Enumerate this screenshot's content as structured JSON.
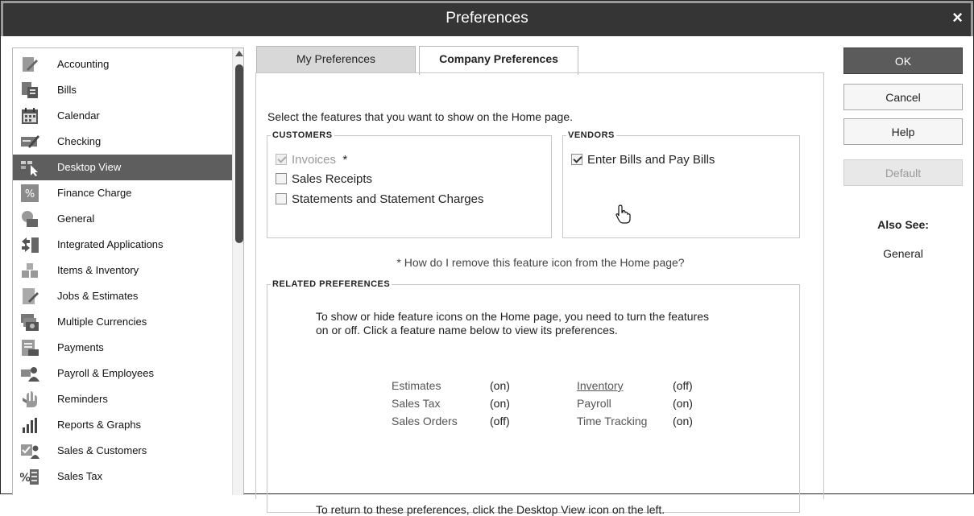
{
  "window": {
    "title": "Preferences",
    "close_glyph": "×"
  },
  "sidebar": {
    "items": [
      {
        "label": "Accounting",
        "icon": "accounting-icon"
      },
      {
        "label": "Bills",
        "icon": "bills-icon"
      },
      {
        "label": "Calendar",
        "icon": "calendar-icon"
      },
      {
        "label": "Checking",
        "icon": "checking-icon"
      },
      {
        "label": "Desktop View",
        "icon": "desktop-view-icon"
      },
      {
        "label": "Finance Charge",
        "icon": "finance-charge-icon"
      },
      {
        "label": "General",
        "icon": "general-icon"
      },
      {
        "label": "Integrated Applications",
        "icon": "integrated-applications-icon"
      },
      {
        "label": "Items & Inventory",
        "icon": "items-inventory-icon"
      },
      {
        "label": "Jobs & Estimates",
        "icon": "jobs-estimates-icon"
      },
      {
        "label": "Multiple Currencies",
        "icon": "multiple-currencies-icon"
      },
      {
        "label": "Payments",
        "icon": "payments-icon"
      },
      {
        "label": "Payroll & Employees",
        "icon": "payroll-employees-icon"
      },
      {
        "label": "Reminders",
        "icon": "reminders-icon"
      },
      {
        "label": "Reports & Graphs",
        "icon": "reports-graphs-icon"
      },
      {
        "label": "Sales & Customers",
        "icon": "sales-customers-icon"
      },
      {
        "label": "Sales Tax",
        "icon": "sales-tax-icon"
      }
    ],
    "selected_index": 4
  },
  "tabs": {
    "my_preferences": "My Preferences",
    "company_preferences": "Company Preferences",
    "active": "company_preferences"
  },
  "content": {
    "intro": "Select the features that you want to show on the Home page.",
    "customers": {
      "legend": "CUSTOMERS",
      "invoices": {
        "label": "Invoices",
        "suffix": "*",
        "checked": true,
        "disabled": true
      },
      "sales_receipts": {
        "label": "Sales Receipts",
        "checked": false
      },
      "statements": {
        "label": "Statements and Statement Charges",
        "checked": false
      }
    },
    "vendors": {
      "legend": "VENDORS",
      "enter_bills": {
        "label": "Enter Bills and Pay Bills",
        "checked": true
      }
    },
    "how_do": "*  How do I remove this feature icon from the Home page?",
    "related": {
      "legend": "RELATED PREFERENCES",
      "text": "To show or hide feature icons on the Home page, you need to turn the features on or off. Click a feature name below to view its preferences.",
      "features": [
        {
          "name": "Estimates",
          "state": "(on)"
        },
        {
          "name": "Sales Tax",
          "state": "(on)"
        },
        {
          "name": "Sales Orders",
          "state": "(off)"
        },
        {
          "name": "Inventory",
          "state": "(off)"
        },
        {
          "name": "Payroll",
          "state": "(on)"
        },
        {
          "name": "Time Tracking",
          "state": "(on)"
        }
      ],
      "footer": "To return to these preferences, click the Desktop View icon on the left."
    }
  },
  "buttons": {
    "ok": "OK",
    "cancel": "Cancel",
    "help": "Help",
    "default": "Default"
  },
  "also_see": {
    "title": "Also See:",
    "links": [
      "General"
    ]
  },
  "colors": {
    "titlebar": "#353535",
    "selected": "#5e5e5e",
    "ok_button": "#5b5b5b"
  }
}
